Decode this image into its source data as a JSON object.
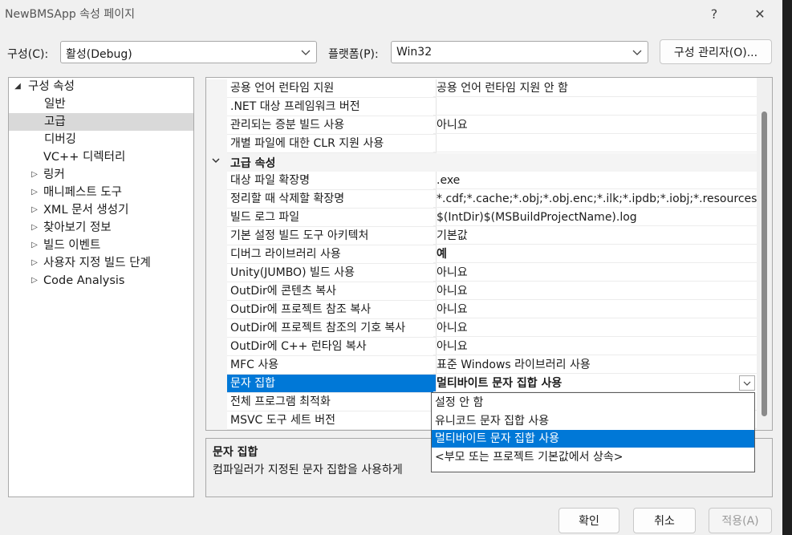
{
  "window": {
    "title": "NewBMSApp 속성 페이지",
    "help_glyph": "?",
    "close_glyph": "✕"
  },
  "toolbar": {
    "config_label": "구성(C):",
    "config_value": "활성(Debug)",
    "platform_label": "플랫폼(P):",
    "platform_value": "Win32",
    "config_manager_label": "구성 관리자(O)..."
  },
  "tree": {
    "root": "구성 속성",
    "items": [
      {
        "label": "일반",
        "expandable": false
      },
      {
        "label": "고급",
        "expandable": false,
        "selected": true
      },
      {
        "label": "디버깅",
        "expandable": false
      },
      {
        "label": "VC++ 디렉터리",
        "expandable": false
      },
      {
        "label": "링커",
        "expandable": true
      },
      {
        "label": "매니페스트 도구",
        "expandable": true
      },
      {
        "label": "XML 문서 생성기",
        "expandable": true
      },
      {
        "label": "찾아보기 정보",
        "expandable": true
      },
      {
        "label": "빌드 이벤트",
        "expandable": true
      },
      {
        "label": "사용자 지정 빌드 단계",
        "expandable": true
      },
      {
        "label": "Code Analysis",
        "expandable": true
      }
    ]
  },
  "grid": {
    "top_rows": [
      {
        "name": "공용 언어 런타임 지원",
        "value": "공용 언어 런타임 지원 안 함"
      },
      {
        "name": ".NET 대상 프레임워크 버전",
        "value": ""
      },
      {
        "name": "관리되는 증분 빌드 사용",
        "value": "아니요"
      },
      {
        "name": "개별 파일에 대한 CLR 지원 사용",
        "value": ""
      }
    ],
    "section_title": "고급 속성",
    "section_rows": [
      {
        "name": "대상 파일 확장명",
        "value": ".exe"
      },
      {
        "name": "정리할 때 삭제할 확장명",
        "value": "*.cdf;*.cache;*.obj;*.obj.enc;*.ilk;*.ipdb;*.iobj;*.resources;*.tlb;*"
      },
      {
        "name": "빌드 로그 파일",
        "value": "$(IntDir)$(MSBuildProjectName).log"
      },
      {
        "name": "기본 설정 빌드 도구 아키텍처",
        "value": "기본값"
      },
      {
        "name": "디버그 라이브러리 사용",
        "value": "예",
        "bold": true
      },
      {
        "name": "Unity(JUMBO) 빌드 사용",
        "value": "아니요"
      },
      {
        "name": "OutDir에 콘텐츠 복사",
        "value": "아니요"
      },
      {
        "name": "OutDir에 프로젝트 참조 복사",
        "value": "아니요"
      },
      {
        "name": "OutDir에 프로젝트 참조의 기호 복사",
        "value": "아니요"
      },
      {
        "name": "OutDir에 C++ 런타임 복사",
        "value": "아니요"
      },
      {
        "name": "MFC 사용",
        "value": "표준 Windows 라이브러리 사용"
      },
      {
        "name": "문자 집합",
        "value": "멀티바이트 문자 집합 사용",
        "bold": true,
        "selected": true
      },
      {
        "name": "전체 프로그램 최적화",
        "value": ""
      },
      {
        "name": "MSVC 도구 세트 버전",
        "value": ""
      }
    ]
  },
  "dropdown": {
    "options": [
      {
        "label": "설정 안 함"
      },
      {
        "label": "유니코드 문자 집합 사용"
      },
      {
        "label": "멀티바이트 문자 집합 사용",
        "selected": true
      },
      {
        "label": "<부모 또는 프로젝트 기본값에서 상속>"
      }
    ]
  },
  "description": {
    "title": "문자 집합",
    "text": "컴파일러가 지정된 문자 집합을 사용하게"
  },
  "footer": {
    "ok_label": "확인",
    "cancel_label": "취소",
    "apply_label": "적용(A)"
  },
  "colors": {
    "selection": "#0078d7",
    "tree_selection": "#d9d9d9",
    "dialog_bg": "#f0f0f0"
  }
}
